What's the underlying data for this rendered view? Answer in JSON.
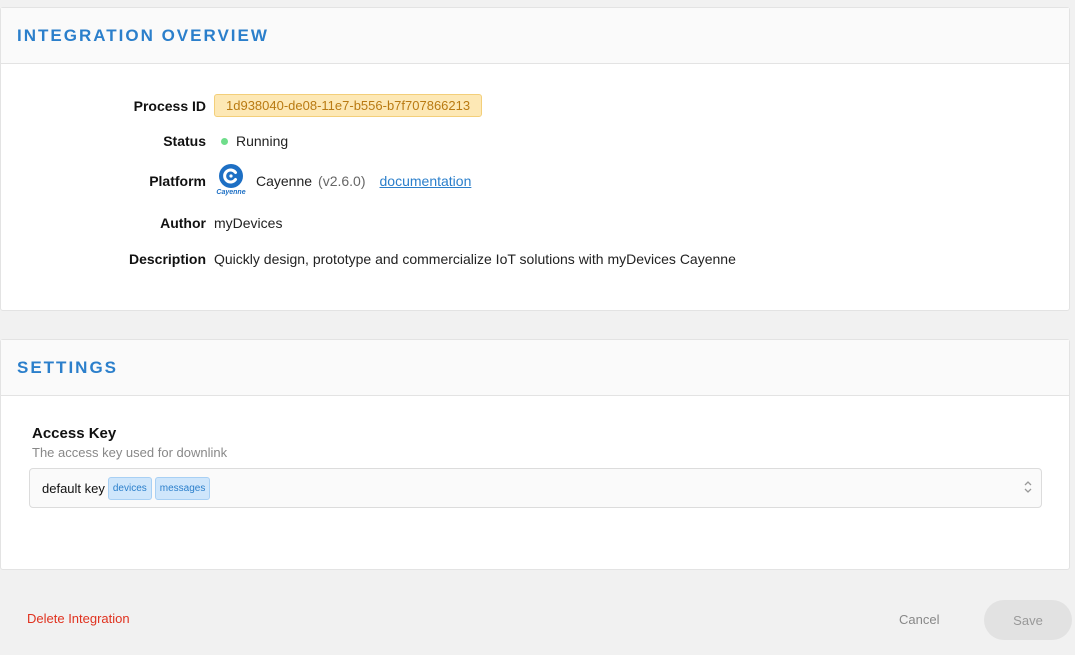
{
  "overview": {
    "title": "INTEGRATION OVERVIEW",
    "process_id_label": "Process ID",
    "process_id": "1d938040-de08-11e7-b556-b7f707866213",
    "status_label": "Status",
    "status": "Running",
    "platform_label": "Platform",
    "platform_logo_text": "Cayenne",
    "platform_name": "Cayenne",
    "platform_version": "(v2.6.0)",
    "documentation_link": "documentation",
    "author_label": "Author",
    "author": "myDevices",
    "description_label": "Description",
    "description": "Quickly design, prototype and commercialize IoT solutions with myDevices Cayenne"
  },
  "settings": {
    "title": "SETTINGS",
    "access_key_label": "Access Key",
    "access_key_help": "The access key used for downlink",
    "access_key_value": "default key",
    "access_key_tags": [
      "devices",
      "messages"
    ]
  },
  "footer": {
    "delete_label": "Delete Integration",
    "cancel_label": "Cancel",
    "save_label": "Save"
  },
  "colors": {
    "accent": "#2b7fcb",
    "status_running": "#6fdd8b",
    "danger": "#e0321f"
  },
  "icons": {
    "platform_logo": "cayenne-logo-icon",
    "status": "status-dot-icon",
    "select": "chevron-up-down-icon"
  }
}
